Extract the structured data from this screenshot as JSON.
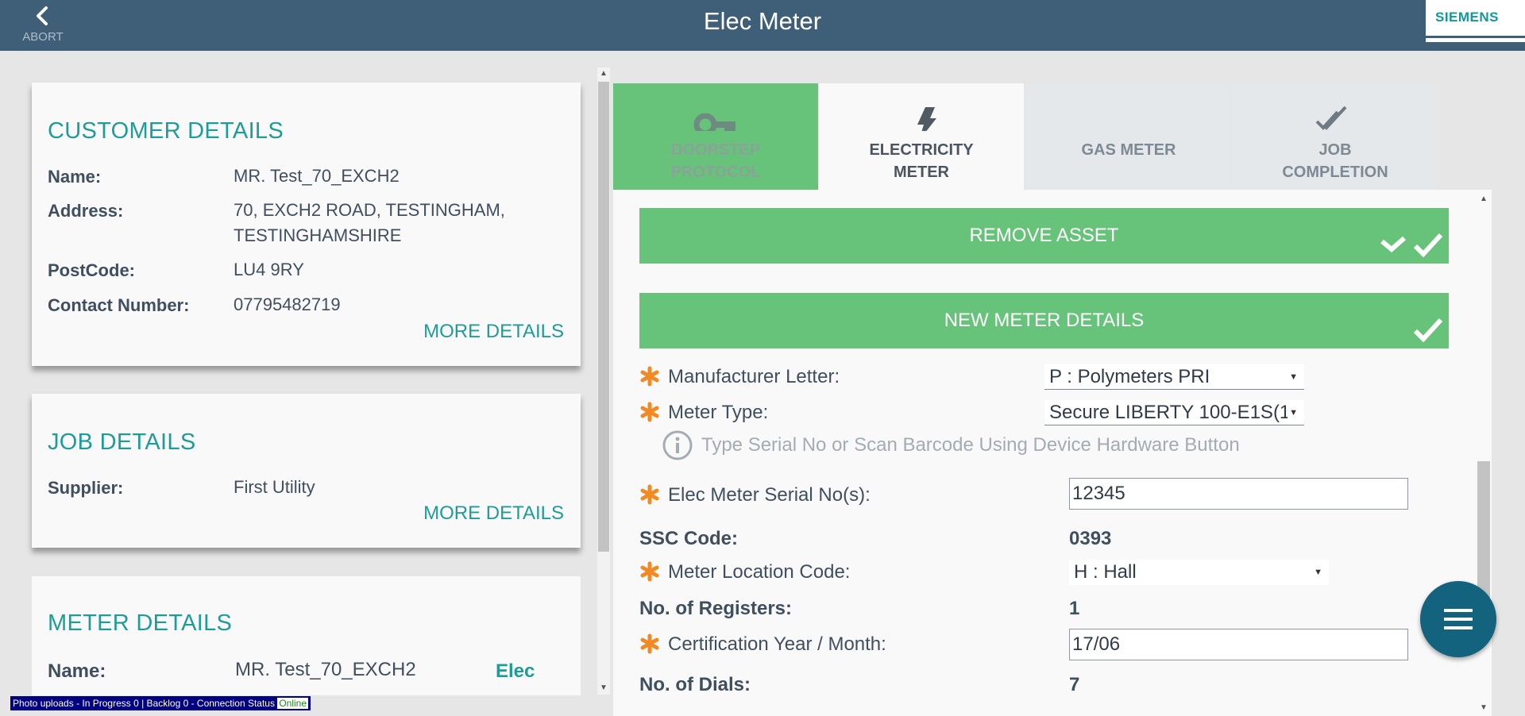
{
  "header": {
    "title": "Elec Meter",
    "abort_label": "ABORT",
    "logo": "SIEMENS"
  },
  "customer": {
    "title": "CUSTOMER DETAILS",
    "fields": [
      {
        "label": "Name:",
        "value": "MR. Test_70_EXCH2"
      },
      {
        "label": "Address:",
        "value": "70, EXCH2 ROAD, TESTINGHAM,",
        "value2": "TESTINGHAMSHIRE"
      },
      {
        "label": "PostCode:",
        "value": "LU4 9RY"
      },
      {
        "label": "Contact Number:",
        "value": "07795482719"
      }
    ],
    "more": "MORE DETAILS"
  },
  "job": {
    "title": "JOB DETAILS",
    "fields": [
      {
        "label": "Supplier:",
        "value": "First Utility"
      }
    ],
    "more": "MORE DETAILS"
  },
  "meter": {
    "title": "METER DETAILS",
    "fields": [
      {
        "label": "Name:",
        "value": "MR. Test_70_EXCH2",
        "tag": "Elec"
      }
    ]
  },
  "tabs": [
    {
      "line1": "DOORSTEP",
      "line2": "PROTOCOL",
      "icon": "key-icon"
    },
    {
      "line1": "ELECTRICITY",
      "line2": "METER",
      "icon": "lightning-icon"
    },
    {
      "line1": "GAS METER",
      "line2": "",
      "icon": "none"
    },
    {
      "line1": "JOB",
      "line2": "COMPLETION",
      "icon": "double-check-icon"
    }
  ],
  "panel": {
    "remove_asset": "REMOVE ASSET",
    "new_meter": "NEW METER DETAILS",
    "manufacturer": {
      "label": "Manufacturer Letter:",
      "value": "P : Polymeters PRI"
    },
    "meter_type": {
      "label": "Meter Type:",
      "value": "Secure LIBERTY 100-E1S(1"
    },
    "hint": "Type Serial No or Scan Barcode Using Device Hardware Button",
    "serial": {
      "label": "Elec Meter Serial No(s):",
      "value": "12345"
    },
    "ssc": {
      "label": "SSC Code:",
      "value": "0393"
    },
    "location": {
      "label": "Meter Location Code:",
      "value": "H : Hall"
    },
    "registers": {
      "label": "No. of Registers:",
      "value": "1"
    },
    "certification": {
      "label": "Certification Year / Month:",
      "value": "17/06"
    },
    "dials": {
      "label": "No. of Dials:",
      "value": "7"
    }
  },
  "status_bar": {
    "text": "Photo uploads - In Progress 0 | Backlog 0 - Connection Status",
    "connection": "Online"
  },
  "colors": {
    "header": "#3f5f78",
    "accent_teal": "#1e9c97",
    "green": "#67c27a",
    "fab": "#13627e",
    "required_star": "#f08a24"
  }
}
